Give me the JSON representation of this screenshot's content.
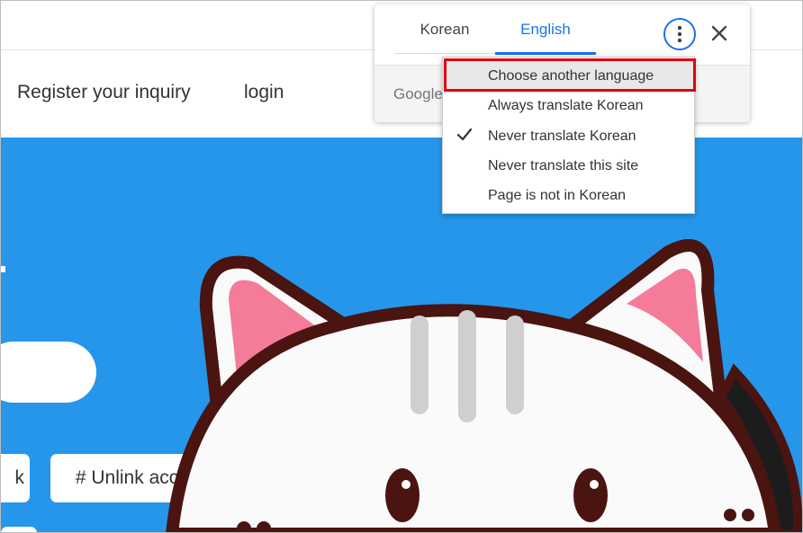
{
  "site": {
    "nav": {
      "register": "Register your inquiry",
      "login": "login"
    },
    "buttons": {
      "left_partial": "k",
      "unlink": "# Unlink account"
    },
    "colors": {
      "hero_bg": "#2596ea",
      "cat_outline": "#4a1410",
      "cat_ear_pink": "#f47c99"
    }
  },
  "translate_popup": {
    "tabs": [
      {
        "label": "Korean",
        "selected": false
      },
      {
        "label": "English",
        "selected": true
      }
    ],
    "more_icon": "more-vert-icon",
    "close_icon": "close-icon",
    "footer_brand": "Google",
    "accent": "#1a73e8",
    "menu": {
      "items": [
        {
          "label": "Choose another language",
          "checked": false,
          "hovered": true
        },
        {
          "label": "Always translate Korean",
          "checked": false
        },
        {
          "label": "Never translate Korean",
          "checked": true
        },
        {
          "label": "Never translate this site",
          "checked": false
        },
        {
          "label": "Page is not in Korean",
          "checked": false
        }
      ],
      "highlight_color": "#e0000f"
    }
  }
}
